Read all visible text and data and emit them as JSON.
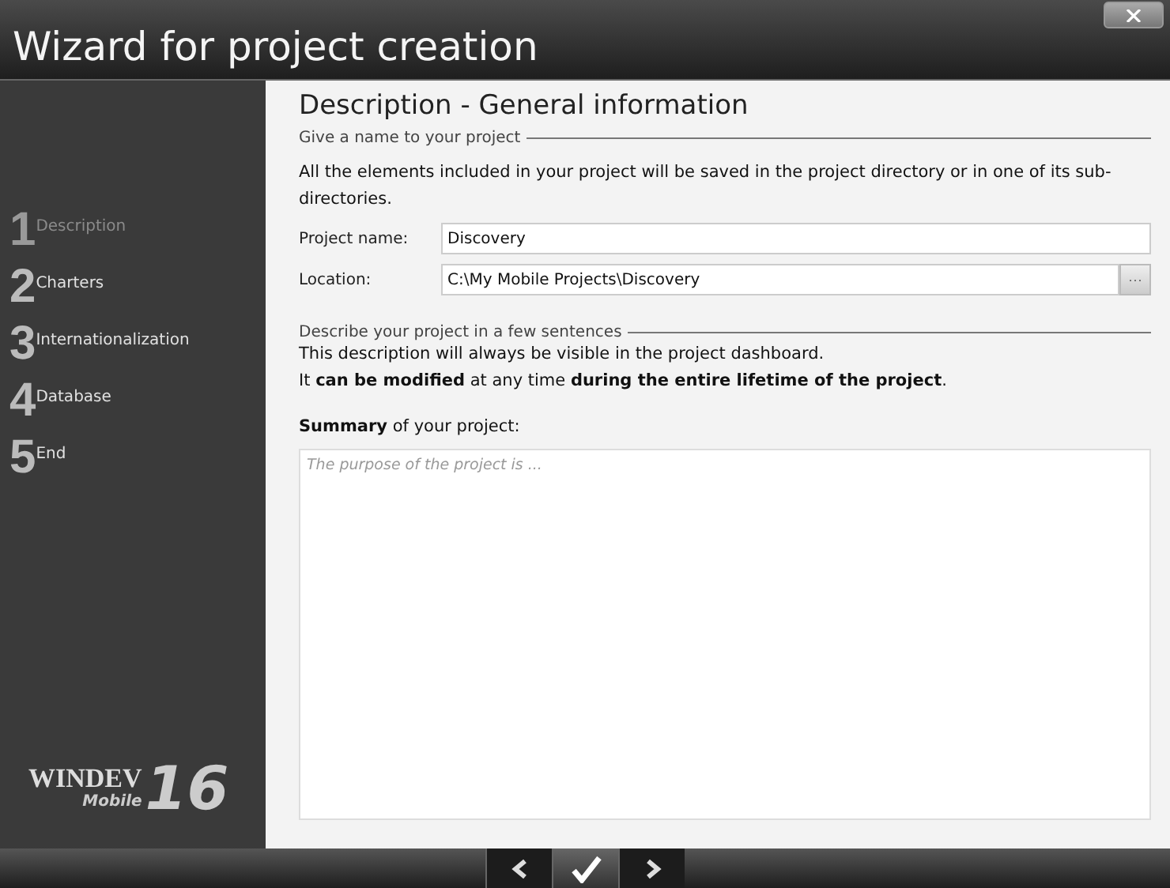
{
  "window": {
    "title": "Wizard for project creation"
  },
  "steps": [
    {
      "number": "1",
      "label": "Description",
      "selected": true
    },
    {
      "number": "2",
      "label": "Charters",
      "selected": false
    },
    {
      "number": "3",
      "label": "Internationalization",
      "selected": false
    },
    {
      "number": "4",
      "label": "Database",
      "selected": false
    },
    {
      "number": "5",
      "label": "End",
      "selected": false
    }
  ],
  "logo": {
    "name": "WINDEV",
    "sub": "Mobile",
    "version": "16"
  },
  "heading": "Description - General information",
  "name_section": {
    "title": "Give a name to your project",
    "text": "All the elements included in your project will be saved in the project directory or in one of its sub-directories.",
    "project_name": {
      "label": "Project name:",
      "value": "Discovery"
    },
    "location": {
      "label": "Location:",
      "value": "C:\\My Mobile Projects\\Discovery",
      "browse": "···"
    }
  },
  "describe_section": {
    "title": "Describe your project in a few sentences",
    "lines": [
      "This description will always be visible in the project dashboard.",
      "It **can be modified** at any time **during the entire lifetime of the project**."
    ],
    "summary_label": "**Summary** of your project:",
    "summary_placeholder": "The purpose of the project is ..."
  },
  "nav": [
    {
      "kind": "back",
      "selected": false
    },
    {
      "kind": "finish",
      "selected": true
    },
    {
      "kind": "next",
      "selected": false
    }
  ]
}
